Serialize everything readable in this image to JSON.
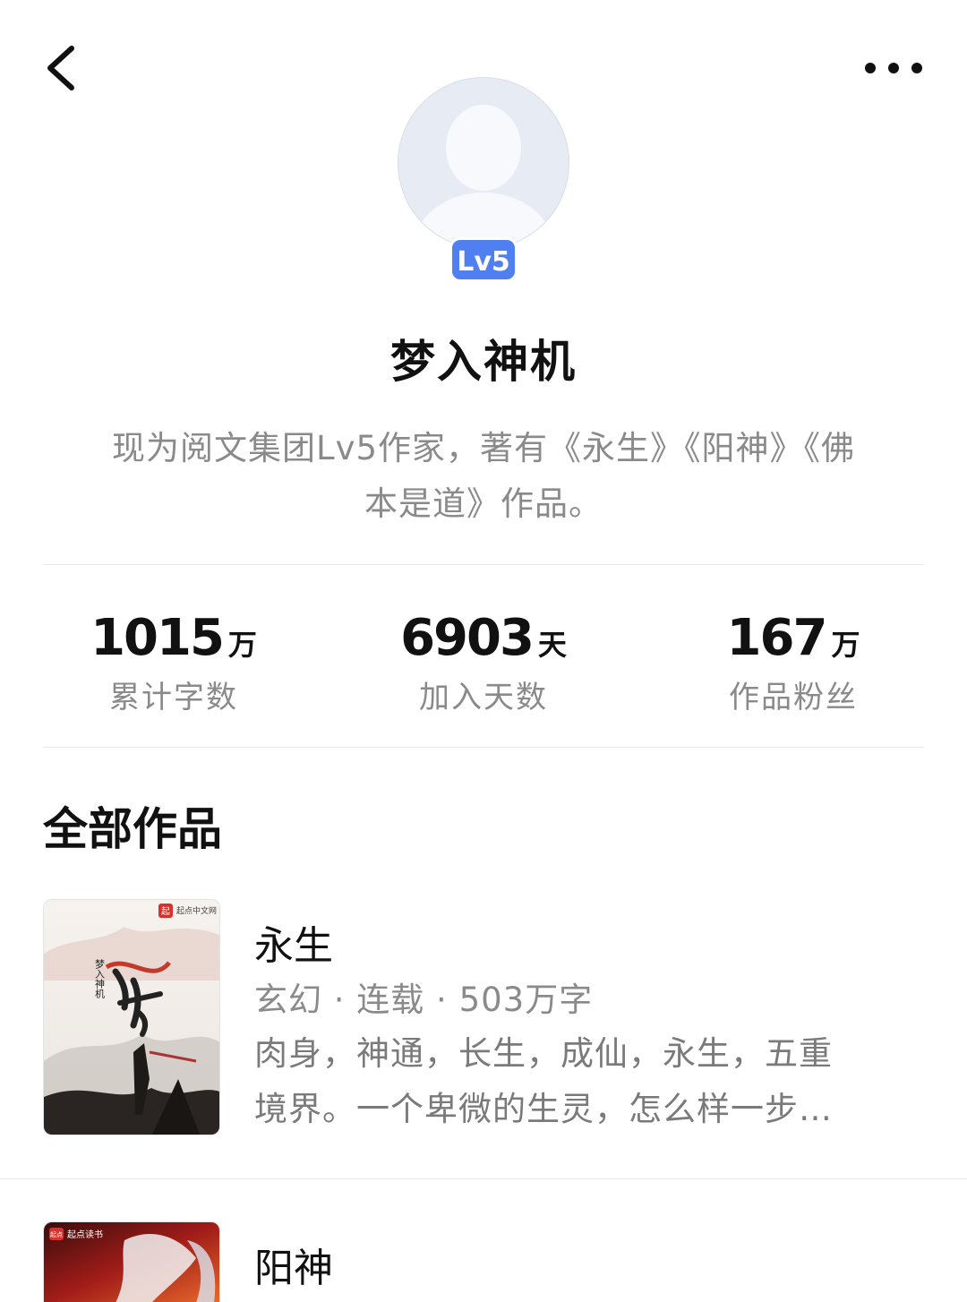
{
  "nav": {
    "back_icon": "chevron-left-icon",
    "more_icon": "more-dots-icon"
  },
  "profile": {
    "level": "Lv5",
    "name": "梦入神机",
    "bio_line1": "现为阅文集团Lv5作家，著有《永生》《阳神》《佛",
    "bio_line2": "本是道》作品。"
  },
  "stats": [
    {
      "value": "1015",
      "unit": "万",
      "label": "累计字数"
    },
    {
      "value": "6903",
      "unit": "天",
      "label": "加入天数"
    },
    {
      "value": "167",
      "unit": "万",
      "label": "作品粉丝"
    }
  ],
  "section": {
    "title": "全部作品"
  },
  "books": [
    {
      "title": "永生",
      "meta": "玄幻 · 连载 · 503万字",
      "desc_line1": "肉身，神通，长生，成仙，永生，五重",
      "desc_line2": "境界。一个卑微的生灵，怎么样一步…",
      "cover": {
        "brand": "起点中文网",
        "brand_mark": "起",
        "author": "梦入神机",
        "title_art": "永生"
      }
    },
    {
      "title": "阳神",
      "cover": {
        "brand": "起点读书",
        "brand_mark": "起点"
      }
    }
  ],
  "colors": {
    "accent": "#4f7ff0",
    "muted_text": "#8a8a8a",
    "divider": "#e8e8e8"
  }
}
